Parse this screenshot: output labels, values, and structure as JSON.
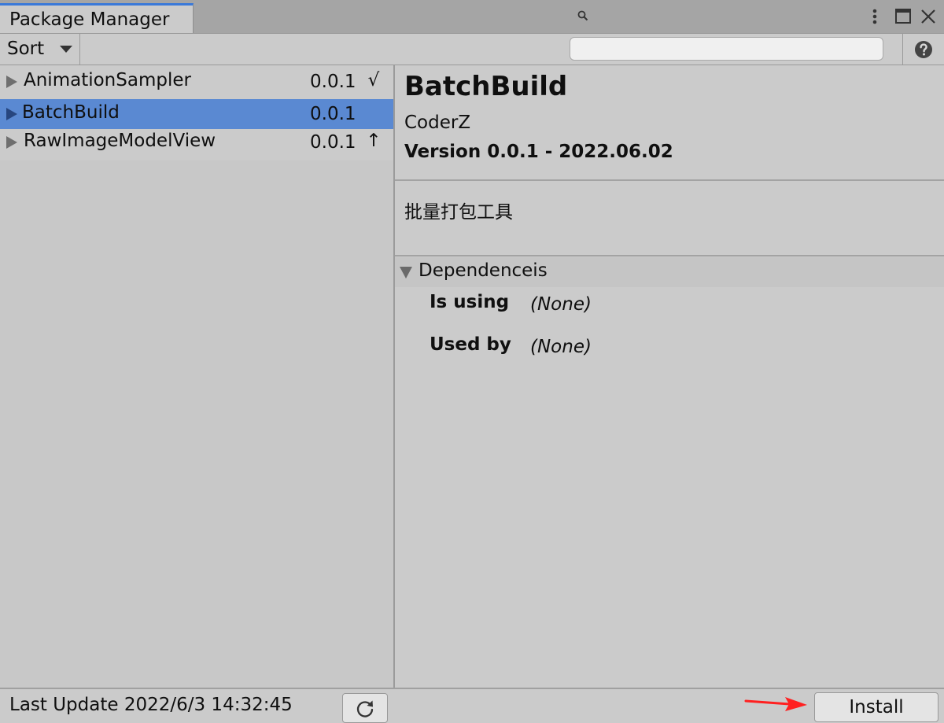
{
  "window": {
    "tab_title": "Package Manager",
    "icons": [
      "more-vertical-icon",
      "maximize-icon",
      "close-icon"
    ]
  },
  "toolbar": {
    "sort_label": "Sort",
    "search_value": "",
    "search_placeholder": "",
    "icons": [
      "chevron-down-icon",
      "search-icon",
      "help-icon"
    ]
  },
  "packages": [
    {
      "name": "AnimationSampler",
      "version": "0.0.1",
      "status": "√",
      "selected": false
    },
    {
      "name": "BatchBuild",
      "version": "0.0.1",
      "status": "",
      "selected": true
    },
    {
      "name": "RawImageModelView",
      "version": "0.0.1",
      "status": "↑",
      "selected": false
    }
  ],
  "details": {
    "title": "BatchBuild",
    "author": "CoderZ",
    "version_line": "Version 0.0.1 - 2022.06.02",
    "description": "批量打包工具",
    "dependencies": {
      "header": "Dependenceis",
      "rows": [
        {
          "key": "Is using",
          "value": "(None)"
        },
        {
          "key": "Used by",
          "value": "(None)"
        }
      ]
    }
  },
  "footer": {
    "last_update": "Last Update 2022/6/3 14:32:45",
    "install_label": "Install"
  },
  "colors": {
    "selection": "#5a89d2",
    "tab_accent": "#3a79d9",
    "annotation_arrow": "#ff2020",
    "panel_bg": "#cbcbcb"
  }
}
